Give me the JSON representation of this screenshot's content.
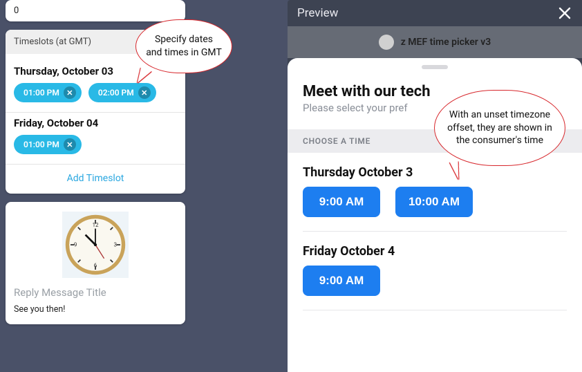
{
  "left": {
    "top_value": "0",
    "timeslots_header": "Timeslots (at GMT)",
    "days": [
      {
        "label": "Thursday, October 03",
        "times": [
          "01:00 PM",
          "02:00 PM"
        ]
      },
      {
        "label": "Friday, October 04",
        "times": [
          "01:00 PM"
        ]
      }
    ],
    "add_label": "Add Timeslot",
    "reply_title_placeholder": "Reply Message Title",
    "reply_body": "See you then!"
  },
  "preview": {
    "header": "Preview",
    "bot_name": "z MEF time picker v3",
    "sheet_title": "Meet with our tech",
    "sheet_subtitle": "Please select your pref",
    "choose_label": "CHOOSE A TIME",
    "days": [
      {
        "label": "Thursday October 3",
        "times": [
          "9:00 AM",
          "10:00 AM"
        ]
      },
      {
        "label": "Friday October 4",
        "times": [
          "9:00 AM"
        ]
      }
    ]
  },
  "callouts": {
    "c1": "Specify dates and times in GMT",
    "c2": "With an unset timezone offset, they are shown in the consumer's time"
  }
}
